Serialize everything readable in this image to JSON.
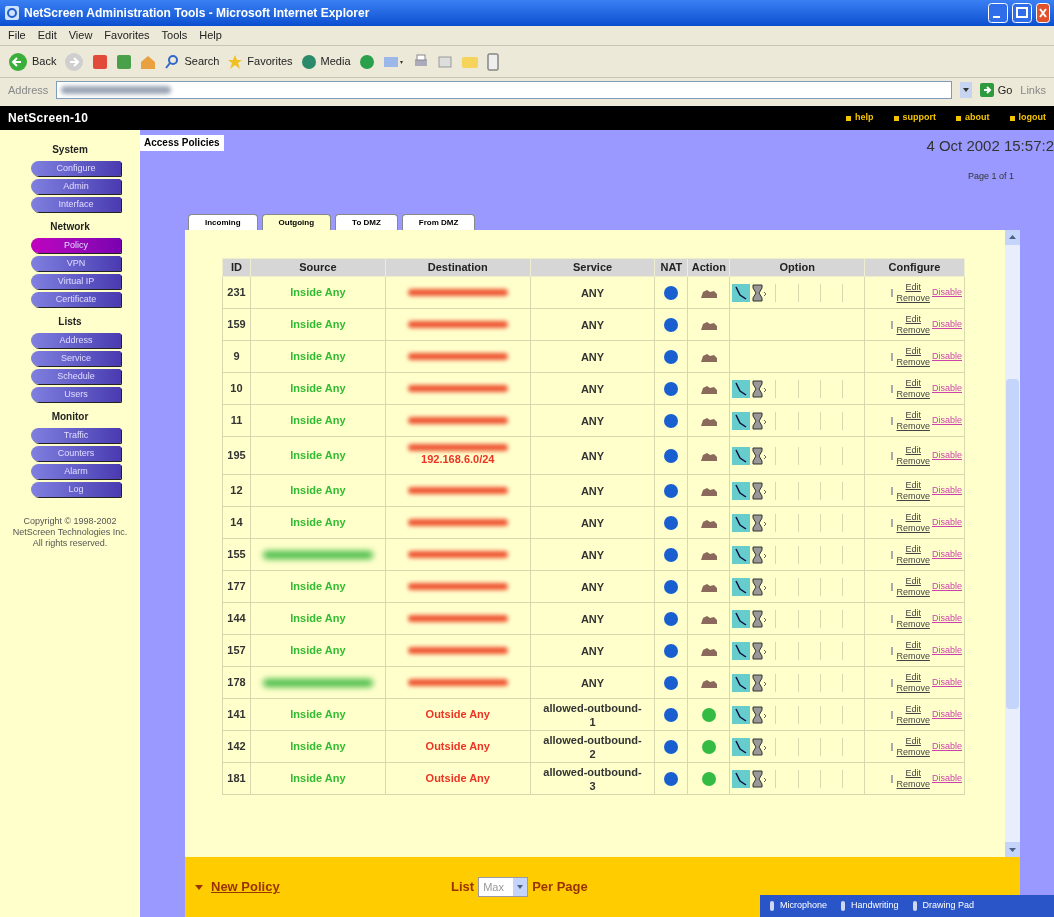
{
  "window": {
    "title": "NetScreen Administration Tools - Microsoft Internet Explorer"
  },
  "menu": [
    "File",
    "Edit",
    "View",
    "Favorites",
    "Tools",
    "Help"
  ],
  "toolbar": {
    "back": "Back",
    "search": "Search",
    "favorites": "Favorites",
    "media": "Media"
  },
  "address_bar": {
    "label": "Address",
    "go": "Go",
    "links": "Links"
  },
  "header": {
    "logo": "NetScreen-10",
    "links": [
      "help",
      "support",
      "about",
      "logout"
    ]
  },
  "sidebar": {
    "sections": [
      {
        "title": "System",
        "items": [
          {
            "label": "Configure",
            "selected": false
          },
          {
            "label": "Admin",
            "selected": false
          },
          {
            "label": "Interface",
            "selected": false
          }
        ]
      },
      {
        "title": "Network",
        "items": [
          {
            "label": "Policy",
            "selected": true
          },
          {
            "label": "VPN",
            "selected": false
          },
          {
            "label": "Virtual IP",
            "selected": false
          },
          {
            "label": "Certificate",
            "selected": false
          }
        ]
      },
      {
        "title": "Lists",
        "items": [
          {
            "label": "Address",
            "selected": false
          },
          {
            "label": "Service",
            "selected": false
          },
          {
            "label": "Schedule",
            "selected": false
          },
          {
            "label": "Users",
            "selected": false
          }
        ]
      },
      {
        "title": "Monitor",
        "items": [
          {
            "label": "Traffic",
            "selected": false
          },
          {
            "label": "Counters",
            "selected": false
          },
          {
            "label": "Alarm",
            "selected": false
          },
          {
            "label": "Log",
            "selected": false
          }
        ]
      }
    ],
    "copyright": "Copyright © 1998-2002 NetScreen Technologies Inc. All rights reserved."
  },
  "page": {
    "title": "Access Policies",
    "datetime": "4 Oct 2002 15:57:2",
    "pager": "Page 1 of 1"
  },
  "tabs": [
    {
      "label": "Incoming",
      "selected": false
    },
    {
      "label": "Outgoing",
      "selected": true
    },
    {
      "label": "To DMZ",
      "selected": false
    },
    {
      "label": "From DMZ",
      "selected": false
    }
  ],
  "table": {
    "columns": [
      "ID",
      "Source",
      "Destination",
      "Service",
      "NAT",
      "Action",
      "Option",
      "Configure"
    ],
    "rows": [
      {
        "id": "231",
        "source": "Inside Any",
        "destination_redacted": true,
        "service": "ANY",
        "kind": "tunnel",
        "options": true,
        "edit": "Edit",
        "remove": "Remove",
        "toggle": "Disable"
      },
      {
        "id": "159",
        "source": "Inside Any",
        "destination_redacted": true,
        "service": "ANY",
        "kind": "tunnel",
        "options": false,
        "edit": "Edit",
        "remove": "Remove",
        "toggle": "Disable"
      },
      {
        "id": "9",
        "source": "Inside Any",
        "destination_redacted": true,
        "service": "ANY",
        "kind": "tunnel",
        "options": false,
        "edit": "Edit",
        "remove": "Remove",
        "toggle": "Disable"
      },
      {
        "id": "10",
        "source": "Inside Any",
        "destination_redacted": true,
        "service": "ANY",
        "kind": "tunnel",
        "options": true,
        "edit": "Edit",
        "remove": "Remove",
        "toggle": "Disable"
      },
      {
        "id": "11",
        "source": "Inside Any",
        "destination_redacted": true,
        "service": "ANY",
        "kind": "tunnel",
        "options": true,
        "edit": "Edit",
        "remove": "Remove",
        "toggle": "Disable"
      },
      {
        "id": "195",
        "source": "Inside Any",
        "destination_redacted": true,
        "destination": "192.168.6.0/24",
        "service": "ANY",
        "kind": "tunnel",
        "options": true,
        "edit": "Edit",
        "remove": "Remove",
        "toggle": "Disable"
      },
      {
        "id": "12",
        "source": "Inside Any",
        "destination_redacted": true,
        "service": "ANY",
        "kind": "tunnel",
        "options": true,
        "edit": "Edit",
        "remove": "Remove",
        "toggle": "Disable"
      },
      {
        "id": "14",
        "source": "Inside Any",
        "destination_redacted": true,
        "service": "ANY",
        "kind": "tunnel",
        "options": true,
        "edit": "Edit",
        "remove": "Remove",
        "toggle": "Disable"
      },
      {
        "id": "155",
        "source_redacted": true,
        "destination_redacted": true,
        "service": "ANY",
        "kind": "tunnel",
        "options": true,
        "edit": "Edit",
        "remove": "Remove",
        "toggle": "Disable"
      },
      {
        "id": "177",
        "source": "Inside Any",
        "destination_redacted": true,
        "service": "ANY",
        "kind": "tunnel",
        "options": true,
        "edit": "Edit",
        "remove": "Remove",
        "toggle": "Disable"
      },
      {
        "id": "144",
        "source": "Inside Any",
        "destination_redacted": true,
        "service": "ANY",
        "kind": "tunnel",
        "options": true,
        "edit": "Edit",
        "remove": "Remove",
        "toggle": "Disable"
      },
      {
        "id": "157",
        "source": "Inside Any",
        "destination_redacted": true,
        "service": "ANY",
        "kind": "tunnel",
        "options": true,
        "edit": "Edit",
        "remove": "Remove",
        "toggle": "Disable"
      },
      {
        "id": "178",
        "source_redacted": true,
        "destination_redacted": true,
        "service": "ANY",
        "kind": "tunnel",
        "options": true,
        "edit": "Edit",
        "remove": "Remove",
        "toggle": "Disable"
      },
      {
        "id": "141",
        "source": "Inside Any",
        "destination": "Outside Any",
        "service": "allowed-outbound-1",
        "kind": "permit",
        "options": true,
        "edit": "Edit",
        "remove": "Remove",
        "toggle": "Disable"
      },
      {
        "id": "142",
        "source": "Inside Any",
        "destination": "Outside Any",
        "service": "allowed-outbound-2",
        "kind": "permit",
        "options": true,
        "edit": "Edit",
        "remove": "Remove",
        "toggle": "Disable"
      },
      {
        "id": "181",
        "source": "Inside Any",
        "destination": "Outside Any",
        "service": "allowed-outbound-3",
        "kind": "permit",
        "options": true,
        "edit": "Edit",
        "remove": "Remove",
        "toggle": "Disable"
      }
    ]
  },
  "footer": {
    "new_policy": "New Policy",
    "list_label": "List",
    "per_page": "Max",
    "per_page_label": "Per Page"
  },
  "language_bar": [
    "Microphone",
    "Handwriting",
    "Drawing Pad"
  ]
}
